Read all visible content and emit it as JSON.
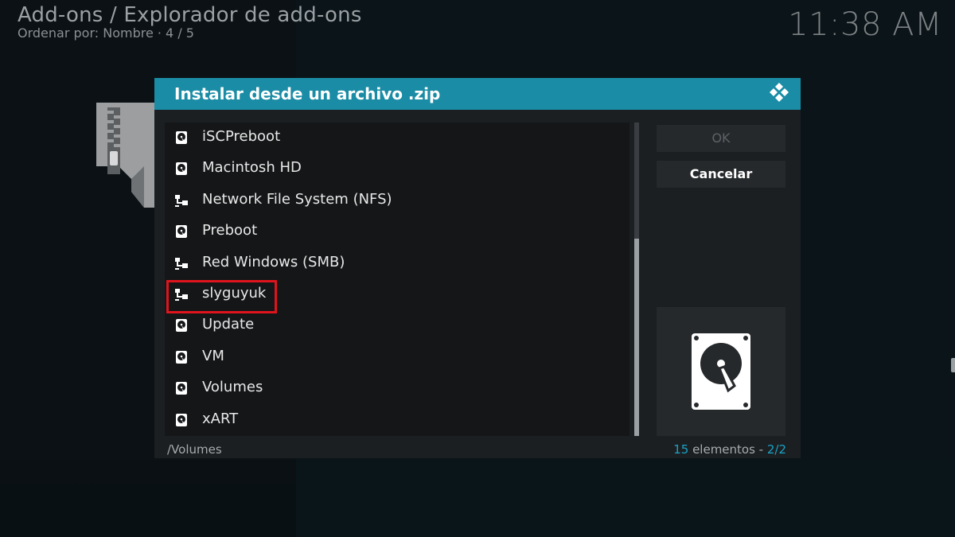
{
  "header": {
    "title": "Add-ons / Explorador de add-ons",
    "subtitle": "Ordenar por: Nombre  ·  4 / 5",
    "clock": "11:38 AM"
  },
  "dialog": {
    "title": "Instalar desde un archivo .zip",
    "items": [
      {
        "label": "iSCPreboot",
        "icon": "hard-drive-icon"
      },
      {
        "label": "Macintosh HD",
        "icon": "hard-drive-icon"
      },
      {
        "label": "Network File System (NFS)",
        "icon": "network-icon"
      },
      {
        "label": "Preboot",
        "icon": "hard-drive-icon"
      },
      {
        "label": "Red Windows (SMB)",
        "icon": "network-icon"
      },
      {
        "label": "slyguyuk",
        "icon": "network-icon"
      },
      {
        "label": "Update",
        "icon": "hard-drive-icon"
      },
      {
        "label": "VM",
        "icon": "hard-drive-icon"
      },
      {
        "label": "Volumes",
        "icon": "hard-drive-icon"
      },
      {
        "label": "xART",
        "icon": "hard-drive-icon"
      }
    ],
    "ok_label": "OK",
    "cancel_label": "Cancelar",
    "current_path": "/Volumes",
    "count_number": "15",
    "count_text": " elementos - ",
    "page": "2/2"
  },
  "colors": {
    "accent": "#1a8ca5",
    "highlight": "#e0141c"
  }
}
